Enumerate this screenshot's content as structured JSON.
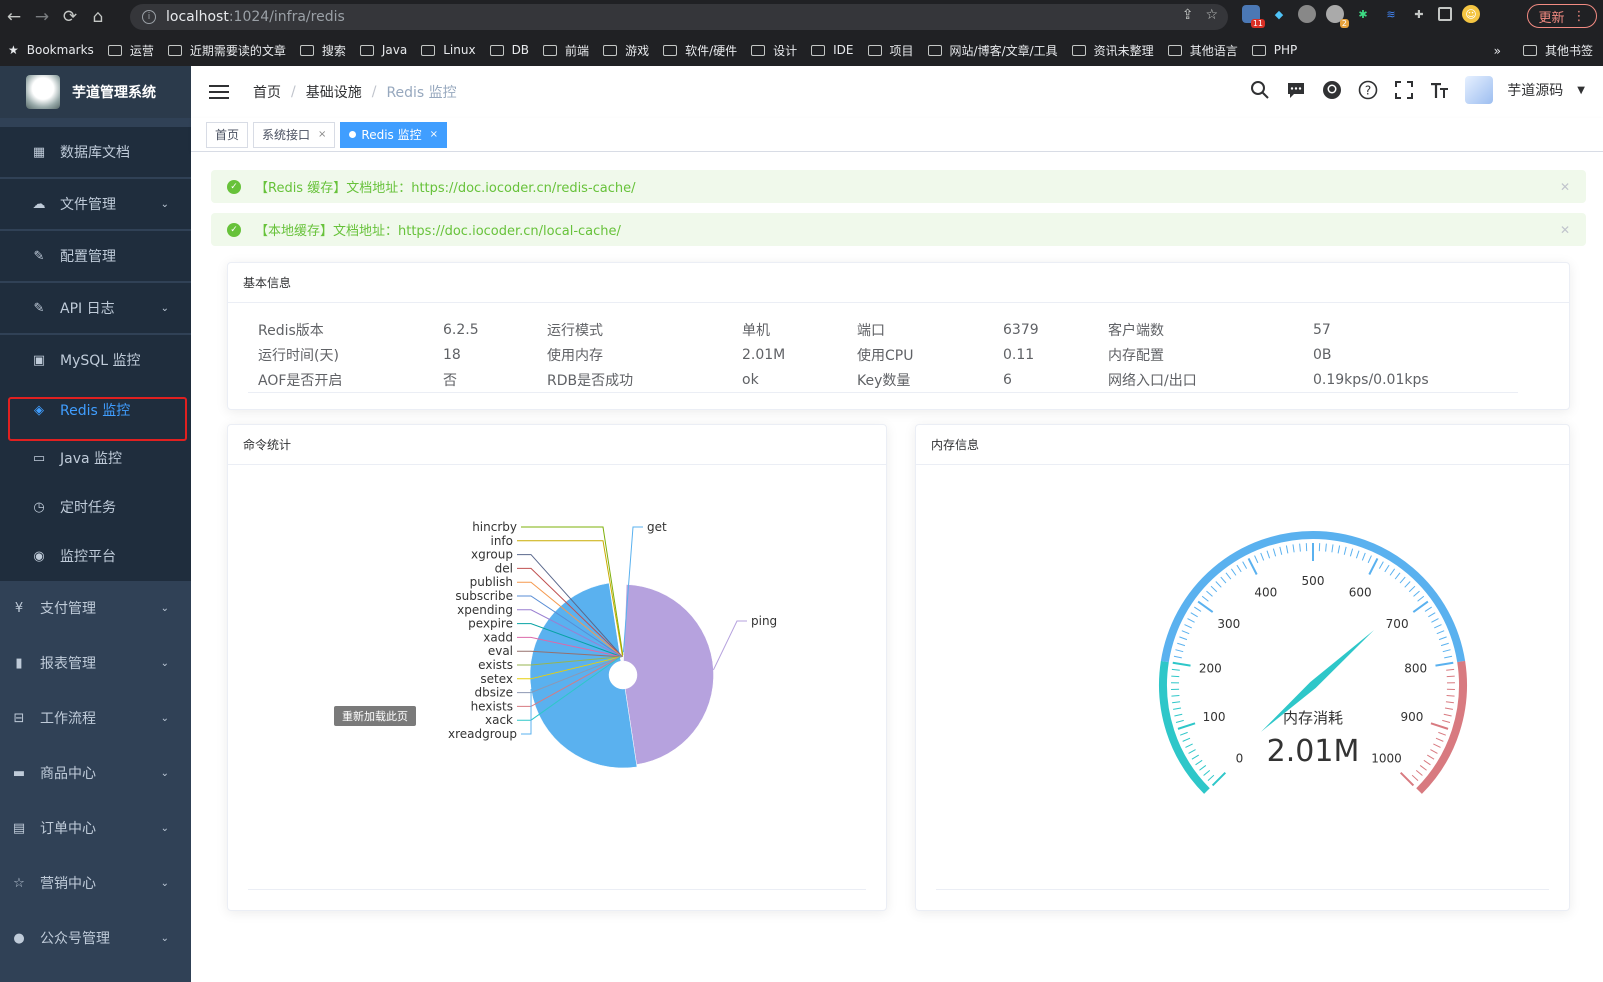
{
  "browser": {
    "url_host": "localhost",
    "url_path": ":1024/infra/redis",
    "update_label": "更新",
    "bookmarks_label": "Bookmarks",
    "bookmarks": [
      "运营",
      "近期需要读的文章",
      "搜索",
      "Java",
      "Linux",
      "DB",
      "前端",
      "游戏",
      "软件/硬件",
      "设计",
      "IDE",
      "项目",
      "网站/博客/文章/工具",
      "资讯未整理",
      "其他语言",
      "PHP"
    ],
    "more_label": "»",
    "other_bookmarks": "其他书签",
    "ext_badges": [
      "11",
      "2"
    ]
  },
  "sidebar": {
    "title": "芋道管理系统",
    "items": [
      {
        "label": "数据库文档",
        "icon": "table-icon"
      },
      {
        "label": "文件管理",
        "icon": "cloud-upload-icon"
      },
      {
        "label": "配置管理",
        "icon": "edit-icon"
      },
      {
        "label": "API 日志",
        "icon": "log-icon"
      },
      {
        "label": "MySQL 监控",
        "icon": "monitor-icon"
      },
      {
        "label": "Redis 监控",
        "icon": "layers-icon"
      },
      {
        "label": "Java 监控",
        "icon": "screen-icon"
      },
      {
        "label": "定时任务",
        "icon": "clock-icon"
      },
      {
        "label": "监控平台",
        "icon": "eye-icon"
      },
      {
        "label": "支付管理",
        "icon": "yen-icon"
      },
      {
        "label": "报表管理",
        "icon": "chart-icon"
      },
      {
        "label": "工作流程",
        "icon": "briefcase-icon"
      },
      {
        "label": "商品中心",
        "icon": "shop-icon"
      },
      {
        "label": "订单中心",
        "icon": "order-icon"
      },
      {
        "label": "营销中心",
        "icon": "star-icon"
      },
      {
        "label": "公众号管理",
        "icon": "wechat-icon"
      }
    ]
  },
  "navbar": {
    "breadcrumb": [
      "首页",
      "基础设施",
      "Redis 监控"
    ],
    "username": "芋道源码"
  },
  "tags": [
    "首页",
    "系统接口",
    "Redis 监控"
  ],
  "alerts": [
    {
      "text": "【Redis 缓存】文档地址：https://doc.iocoder.cn/redis-cache/"
    },
    {
      "text": "【本地缓存】文档地址：https://doc.iocoder.cn/local-cache/"
    }
  ],
  "basic_info": {
    "title": "基本信息",
    "rows": [
      [
        "Redis版本",
        "6.2.5",
        "运行模式",
        "单机",
        "端口",
        "6379",
        "客户端数",
        "57"
      ],
      [
        "运行时间(天)",
        "18",
        "使用内存",
        "2.01M",
        "使用CPU",
        "0.11",
        "内存配置",
        "0B"
      ],
      [
        "AOF是否开启",
        "否",
        "RDB是否成功",
        "ok",
        "Key数量",
        "6",
        "网络入口/出口",
        "0.19kps/0.01kps"
      ]
    ]
  },
  "command_stats": {
    "title": "命令统计",
    "reload_tip": "重新加载此页"
  },
  "memory_info": {
    "title": "内存信息"
  },
  "chart_data": [
    {
      "type": "pie",
      "labels": [
        "get",
        "ping",
        "xreadgroup",
        "xack",
        "hexists",
        "dbsize",
        "setex",
        "exists",
        "eval",
        "xadd",
        "pexpire",
        "xpending",
        "subscribe",
        "publish",
        "del",
        "xgroup",
        "info",
        "hincrby"
      ],
      "values": [
        0.6,
        47,
        50,
        0.15,
        0.15,
        0.15,
        0.15,
        0.15,
        0.15,
        0.15,
        0.15,
        0.15,
        0.15,
        0.15,
        0.15,
        0.15,
        0.15,
        0.3
      ],
      "colors": [
        "#5ab1ef",
        "#b6a2de",
        "#5ab1ef",
        "#2ec7c9",
        "#d87a80",
        "#8d98b3",
        "#e5cf0d",
        "#97b552",
        "#95706d",
        "#dc69aa",
        "#07a2a4",
        "#9a7fd1",
        "#588dd5",
        "#f5994e",
        "#c05050",
        "#59678c",
        "#c9ab00",
        "#7eb00a"
      ]
    },
    {
      "type": "gauge",
      "min": 0,
      "max": 1000,
      "value": 2.01,
      "ticks": [
        "0",
        "100",
        "200",
        "300",
        "400",
        "500",
        "600",
        "700",
        "800",
        "900",
        "1000"
      ],
      "detail": "2.01M",
      "name": "内存消耗"
    }
  ]
}
